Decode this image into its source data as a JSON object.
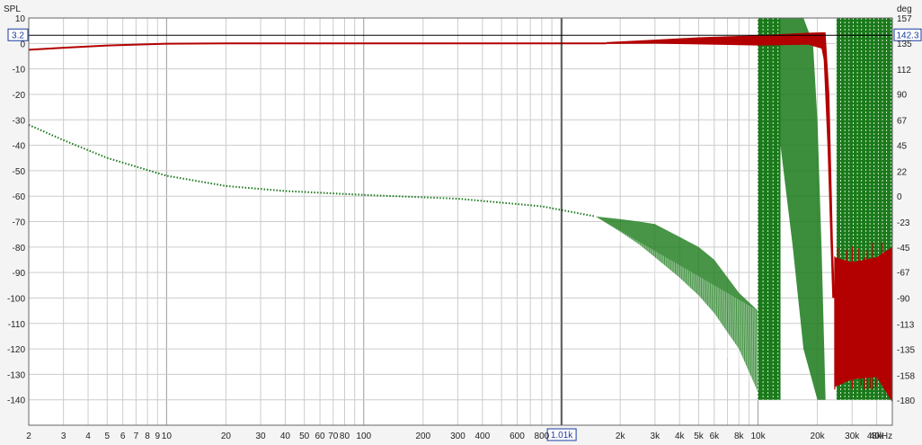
{
  "chart_data": {
    "type": "line",
    "left_axis_label": "SPL",
    "right_axis_label": "deg",
    "x_unit": "Hz",
    "x_scale": "log",
    "xlim": [
      2,
      48000
    ],
    "ylim_left": [
      -150,
      10
    ],
    "ylim_right": [
      -202,
      157
    ],
    "grid": true,
    "x_tick_labels": [
      {
        "v": 2,
        "t": "2"
      },
      {
        "v": 3,
        "t": "3"
      },
      {
        "v": 4,
        "t": "4"
      },
      {
        "v": 5,
        "t": "5"
      },
      {
        "v": 6,
        "t": "6"
      },
      {
        "v": 7,
        "t": "7"
      },
      {
        "v": 8,
        "t": "8"
      },
      {
        "v": 9,
        "t": "9"
      },
      {
        "v": 10,
        "t": "10"
      },
      {
        "v": 20,
        "t": "20"
      },
      {
        "v": 30,
        "t": "30"
      },
      {
        "v": 40,
        "t": "40"
      },
      {
        "v": 50,
        "t": "50"
      },
      {
        "v": 60,
        "t": "60"
      },
      {
        "v": 70,
        "t": "70"
      },
      {
        "v": 80,
        "t": "80"
      },
      {
        "v": 100,
        "t": "100"
      },
      {
        "v": 200,
        "t": "200"
      },
      {
        "v": 300,
        "t": "300"
      },
      {
        "v": 400,
        "t": "400"
      },
      {
        "v": 600,
        "t": "600"
      },
      {
        "v": 800,
        "t": "800"
      },
      {
        "v": 2000,
        "t": "2k"
      },
      {
        "v": 3000,
        "t": "3k"
      },
      {
        "v": 4000,
        "t": "4k"
      },
      {
        "v": 5000,
        "t": "5k"
      },
      {
        "v": 6000,
        "t": "6k"
      },
      {
        "v": 8000,
        "t": "8k"
      },
      {
        "v": 10000,
        "t": "10k"
      },
      {
        "v": 20000,
        "t": "20k"
      },
      {
        "v": 30000,
        "t": "30k"
      },
      {
        "v": 40000,
        "t": "40k"
      },
      {
        "v": 48000,
        "t": "48kHz"
      }
    ],
    "y_left_ticks": [
      10,
      0,
      -10,
      -20,
      -30,
      -40,
      -50,
      -60,
      -70,
      -80,
      -90,
      -100,
      -110,
      -120,
      -130,
      -140
    ],
    "y_right_ticks": [
      157,
      135,
      112,
      90,
      67,
      45,
      22,
      0,
      -23,
      -45,
      -67,
      -90,
      -113,
      -135,
      -158,
      -180
    ],
    "cursor": {
      "x_value": 1010,
      "x_label": "1.01k",
      "y_left_value": 3.2,
      "y_left_label": "3.2",
      "y_right_label": "142.3"
    },
    "series": [
      {
        "axis": "left",
        "color": "#b30000",
        "style": "solid",
        "points": [
          [
            2,
            -2.5
          ],
          [
            3,
            -1.7
          ],
          [
            5,
            -0.8
          ],
          [
            10,
            -0.1
          ],
          [
            20,
            0
          ],
          [
            100,
            0
          ],
          [
            1000,
            0
          ],
          [
            1700,
            0
          ],
          [
            5000,
            1.5
          ],
          [
            10000,
            2.6
          ],
          [
            18000,
            3.8
          ],
          [
            22000,
            3.8
          ],
          [
            23000,
            -20
          ],
          [
            24500,
            -90
          ],
          [
            26000,
            -95
          ],
          [
            35000,
            -95
          ],
          [
            48000,
            -88
          ]
        ]
      },
      {
        "axis": "right",
        "color": "#1a7a1a",
        "style": "dotted",
        "points": [
          [
            2,
            -32
          ],
          [
            3,
            -38
          ],
          [
            5,
            -45
          ],
          [
            10,
            -52
          ],
          [
            20,
            -56
          ],
          [
            40,
            -58
          ],
          [
            100,
            -59.5
          ],
          [
            300,
            -61
          ],
          [
            800,
            -64
          ],
          [
            1500,
            -68
          ],
          [
            2000,
            -70
          ],
          [
            3000,
            -76
          ],
          [
            5000,
            -93
          ],
          [
            8000,
            -120
          ],
          [
            10000,
            -137
          ]
        ]
      }
    ],
    "colors": {
      "grid": "#cccccc",
      "frame": "#666666",
      "spl": "#b30000",
      "phase": "#1a7a1a",
      "cursor": "#000000",
      "cursor_box": "#1a3aa0"
    }
  }
}
